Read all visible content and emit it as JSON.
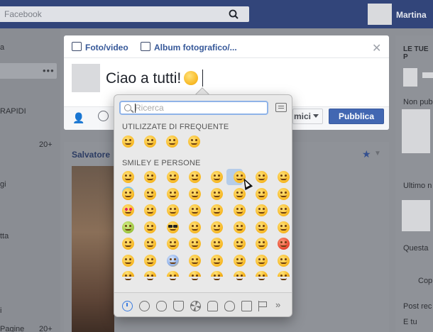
{
  "topbar": {
    "search_placeholder": "Facebook",
    "user_name": "Martina"
  },
  "left_column": {
    "items": [
      "a",
      "RAPIDI",
      "20+",
      "gi",
      "tta",
      "i",
      "Pagine",
      "20+"
    ]
  },
  "right_column": {
    "heading": "LE TUE P",
    "items": [
      "Non pub",
      "Ultimo n",
      "Questa",
      "Cop",
      "Post rec",
      "E tu"
    ]
  },
  "composer": {
    "tabs": [
      {
        "label": "Foto/video",
        "icon": "camera-icon"
      },
      {
        "label": "Album fotografico/...",
        "icon": "album-icon"
      }
    ],
    "text": "Ciao a tutti!",
    "inserted_emoji": "grinning-face",
    "audience_label": "mici",
    "publish_label": "Pubblica"
  },
  "post": {
    "author": "Salvatore"
  },
  "emoji_picker": {
    "search_placeholder": "Ricerca",
    "frequent_heading": "UTILIZZATE DI FREQUENTE",
    "people_heading": "SMILEY E PERSONE",
    "frequent": [
      "grinning-face",
      "face-blowing-kiss",
      "face-with-tears-of-joy",
      "grinning-face-smiling-eyes"
    ],
    "people_rows": [
      [
        "grinning-face",
        "grinning-face-big-eyes",
        "grinning-face-smiling-eyes",
        "face-with-tears-of-joy",
        "smiling-face-open-mouth",
        "grinning-smiling-eyes-selected",
        "grinning-face-sweat",
        "squinting-face"
      ],
      [
        "smiling-face-halo",
        "winking-face",
        "smiling-face-smiling-eyes",
        "slightly-smiling-face",
        "upside-down-face",
        "smiling-face",
        "yum-face",
        "relieved-face"
      ],
      [
        "heart-eyes-face",
        "face-blowing-kiss",
        "kissing-face",
        "kissing-face-smiling-eyes",
        "kissing-closed-eyes",
        "winking-tongue",
        "squinting-tongue",
        "face-with-tongue"
      ],
      [
        "money-mouth-face",
        "nerd-face",
        "sunglasses-face",
        "hugging-face",
        "smirking-face",
        "unamused-face",
        "expressionless-face",
        "neutral-face"
      ],
      [
        "pensive-face",
        "confused-face",
        "slightly-frowning-face",
        "frowning-face",
        "persevering-face",
        "confounded-face",
        "disappointed-face",
        "pouting-face"
      ],
      [
        "triumph-face",
        "open-mouth-face",
        "screaming-face",
        "fearful-face",
        "anxious-face",
        "hushed-face",
        "crying-face",
        "weary-face"
      ],
      [
        "face-partial",
        "face-partial",
        "face-partial",
        "face-partial",
        "face-partial",
        "face-partial",
        "face-partial",
        "face-partial"
      ]
    ],
    "categories": [
      "recent-icon",
      "smiley-icon",
      "animal-icon",
      "food-icon",
      "activity-icon",
      "travel-icon",
      "objects-icon",
      "symbols-icon",
      "flag-icon",
      "more-icon"
    ],
    "more_glyph": "»"
  },
  "colors": {
    "fb_blue": "#4267b2",
    "topbar": "#32457a",
    "selection": "#b6cde9"
  }
}
